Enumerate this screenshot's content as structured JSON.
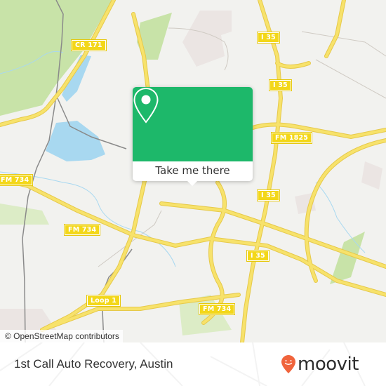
{
  "map": {
    "attribution": "© OpenStreetMap contributors",
    "road_labels": [
      {
        "id": "cr-171",
        "text": "CR 171"
      },
      {
        "id": "i35-top",
        "text": "I 35"
      },
      {
        "id": "i35-mid",
        "text": "I 35"
      },
      {
        "id": "fm-1825",
        "text": "FM 1825"
      },
      {
        "id": "fm-734-left",
        "text": "FM 734"
      },
      {
        "id": "fm-734-center",
        "text": "FM 734"
      },
      {
        "id": "i35-lower",
        "text": "I 35"
      },
      {
        "id": "i35-bottom",
        "text": "I 35"
      },
      {
        "id": "loop-1",
        "text": "Loop 1"
      },
      {
        "id": "fm-734-bottom",
        "text": "FM 734"
      }
    ],
    "colors": {
      "land": "#f2f2ef",
      "road": "#f7e26b",
      "water": "#a8d8f0",
      "park": "#c8e3a8",
      "urban": "#ebe5e3"
    }
  },
  "popup": {
    "icon": "map-pin-icon",
    "button_label": "Take me there",
    "accent_color": "#1db86a"
  },
  "footer": {
    "place_name": "1st Call Auto Recovery, Austin",
    "brand": "moovit",
    "brand_color": "#f0643c"
  }
}
